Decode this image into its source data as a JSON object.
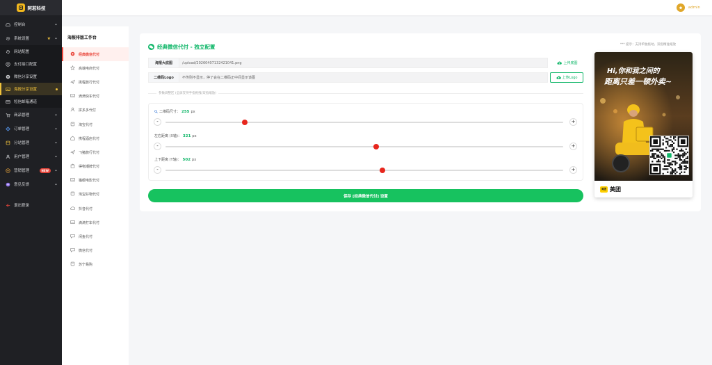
{
  "brand": {
    "name": "阿若科技"
  },
  "sidebar": {
    "items": [
      {
        "label": "控制台",
        "icon": "dashboard-icon",
        "chevron": true
      },
      {
        "label": "系统设置",
        "icon": "gear-icon",
        "chevron": true,
        "star": true
      },
      {
        "label": "网站配置",
        "icon": "gear-icon",
        "sub": true
      },
      {
        "label": "支付接口配置",
        "icon": "pay-icon",
        "sub": true
      },
      {
        "label": "微信分享设置",
        "icon": "wechat-icon",
        "sub": true
      },
      {
        "label": "海报分享设置",
        "icon": "image-icon",
        "sub": true,
        "active": true
      },
      {
        "label": "短信邮箱通道",
        "icon": "mail-icon",
        "sub": true
      },
      {
        "label": "商品管理",
        "icon": "cart-icon",
        "chevron": true
      },
      {
        "label": "订单管理",
        "icon": "order-icon",
        "chevron": true
      },
      {
        "label": "分站管理",
        "icon": "site-icon",
        "chevron": true
      },
      {
        "label": "用户管理",
        "icon": "user-icon",
        "chevron": true
      },
      {
        "label": "营销管理",
        "icon": "gift-icon",
        "chevron": true,
        "badge": "NEW"
      },
      {
        "label": "意见反馈",
        "icon": "feedback-icon",
        "chevron": true
      },
      {
        "label": "退出登录",
        "icon": "logout-icon"
      }
    ]
  },
  "header": {
    "username": "admin"
  },
  "panel": {
    "title": "海报排版工作台",
    "items": [
      "经典微信代付",
      "高端电商代付",
      "携程旅行代付",
      "滴滴快车代付",
      "拼多多代付",
      "淘宝代付",
      "携程酒店代付",
      "飞猪旅行代付",
      "得物潮牌代付",
      "猫眼电影代付",
      "淘宝好物代付",
      "抖音代付",
      "滴滴打车代付",
      "闲鱼代付",
      "微信代付",
      "苏宁易购"
    ]
  },
  "main": {
    "title": "经典微信代付 - 独立配置",
    "tip": "*** 提示：支持单独拖动，双指精准缩放",
    "bg_label": "海报大底图",
    "bg_value": "/upload/20260407132421041.png",
    "bg_button": "上传底图",
    "logo_label": "二维码Logo",
    "logo_placeholder": "不传则不显示，停了会在二维码正中间显示该图",
    "logo_button": "上传Logo",
    "divider": "参数调整区 (全屏支持手指拖拽/双指缩放)",
    "sliders": [
      {
        "label": "二维码尺寸：",
        "value": 255,
        "unit": "px",
        "fraction": 0.2
      },
      {
        "label": "左右距离 (X轴)：",
        "value": 321,
        "unit": "px",
        "fraction": 0.53
      },
      {
        "label": "上下距离 (Y轴)：",
        "value": 502,
        "unit": "px",
        "fraction": 0.545
      }
    ],
    "minus": "-",
    "plus": "+",
    "save": "保存 [经典微信代付] 设置"
  },
  "poster": {
    "headline_1": "Hi,你和我之间的",
    "headline_2": "距离只差一顿外卖~",
    "brand_logo": "美团",
    "brand_name": "美团"
  },
  "colors": {
    "sidebar_bg": "#1f2024",
    "accent_gold": "#f0c23c",
    "accent_green": "#12b76a",
    "active_red": "#e9453a",
    "save_green": "#17c25f"
  }
}
